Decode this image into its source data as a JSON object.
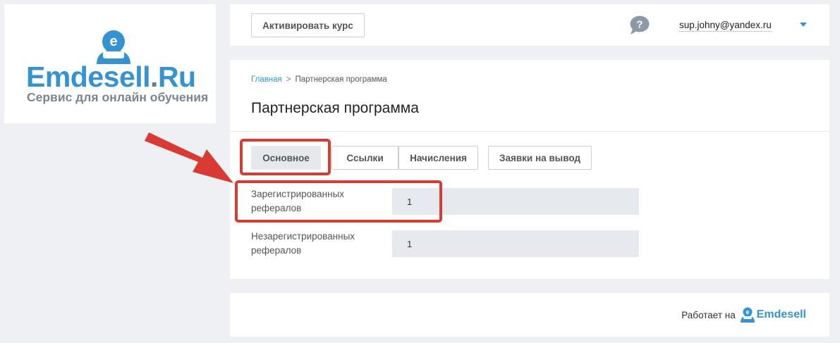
{
  "brand": {
    "logo_name": "Emdesell",
    "logo_dot": ".",
    "logo_tld": "Ru",
    "tagline": "Сервис для онлайн обучения"
  },
  "header": {
    "activate_course_label": "Активировать курс",
    "help_icon": "question-bubble-icon",
    "user_email": "sup.johny@yandex.ru",
    "dropdown_icon": "caret-down-icon"
  },
  "breadcrumb": {
    "home": "Главная",
    "separator": ">",
    "current": "Партнерская программа"
  },
  "page": {
    "title": "Партнерская программа"
  },
  "tabs": [
    {
      "label": "Основное",
      "active": true
    },
    {
      "label": "Ссылки",
      "active": false
    },
    {
      "label": "Начисления",
      "active": false
    },
    {
      "label": "Заявки на вывод",
      "active": false
    }
  ],
  "fields": [
    {
      "label": "Зарегистрированных рефералов",
      "value": "1"
    },
    {
      "label": "Незарегистрированных рефералов",
      "value": "1"
    }
  ],
  "footer": {
    "powered_by": "Работает на",
    "brand": "Emdesell"
  },
  "colors": {
    "accent": "#3593d1",
    "highlight": "#d93a32",
    "background": "#eef0f3"
  }
}
